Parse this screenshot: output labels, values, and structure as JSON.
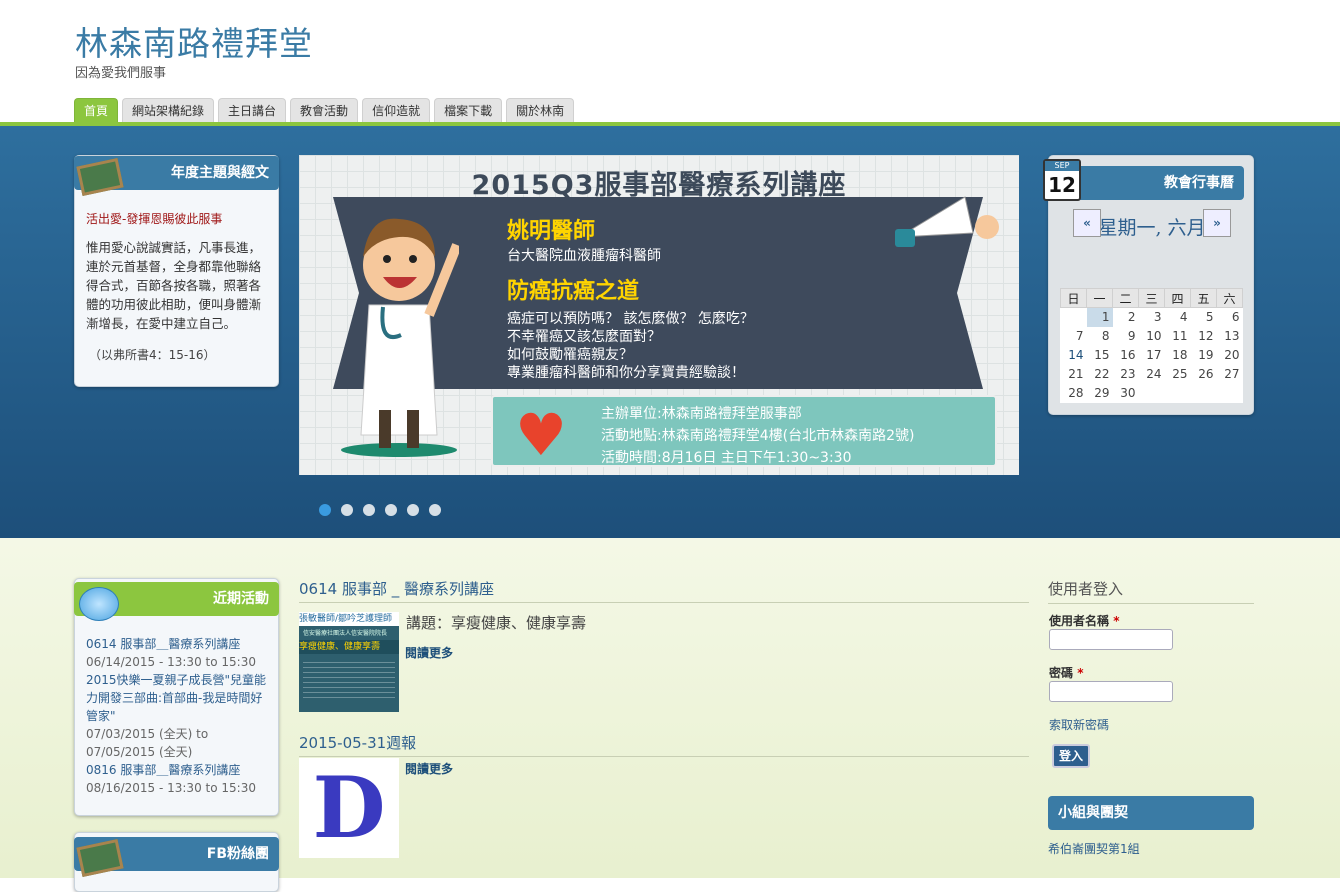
{
  "header": {
    "site_name": "林森南路禮拜堂",
    "slogan": "因為愛我們服事"
  },
  "nav": {
    "tabs": [
      "首頁",
      "網站架構紀錄",
      "主日講台",
      "教會活動",
      "信仰造就",
      "檔案下載",
      "關於林南"
    ],
    "active": 0
  },
  "theme_block": {
    "title": "年度主題與經文",
    "subtitle": "活出愛-發揮恩賜彼此服事",
    "text": "惟用愛心說誠實話，凡事長進，連於元首基督，全身都靠他聯絡得合式，百節各按各職，照著各體的功用彼此相助，便叫身體漸漸增長，在愛中建立自己。",
    "reference": "（以弗所書4：15-16）"
  },
  "slide": {
    "title": "2015Q3服事部醫療系列講座",
    "doctor_name": "姚明醫師",
    "doctor_role": "台大醫院血液腫瘤科醫師",
    "talk_title": "防癌抗癌之道",
    "questions": [
      "癌症可以預防嗎？ 該怎麼做？ 怎麼吃？",
      "不幸罹癌又該怎麼面對？",
      "如何鼓勵罹癌親友？",
      "專業腫瘤科醫師和你分享寶貴經驗談！"
    ],
    "info": [
      "主辦單位:林森南路禮拜堂服事部",
      "活動地點:林森南路禮拜堂4樓(台北市林森南路2號)",
      "活動時間:8月16日 主日下午1:30~3:30"
    ],
    "dot_count": 6,
    "active_dot": 0
  },
  "calendar": {
    "title": "教會行事曆",
    "icon_month": "SEP",
    "icon_day": "12",
    "month_label": "星期一, 六月",
    "prev": "«",
    "next": "»",
    "weekdays": [
      "日",
      "一",
      "二",
      "三",
      "四",
      "五",
      "六"
    ],
    "weeks": [
      [
        "",
        "1",
        "2",
        "3",
        "4",
        "5",
        "6"
      ],
      [
        "7",
        "8",
        "9",
        "10",
        "11",
        "12",
        "13"
      ],
      [
        "14",
        "15",
        "16",
        "17",
        "18",
        "19",
        "20"
      ],
      [
        "21",
        "22",
        "23",
        "24",
        "25",
        "26",
        "27"
      ],
      [
        "28",
        "29",
        "30",
        "",
        "",
        "",
        ""
      ]
    ]
  },
  "events_block": {
    "title": "近期活動",
    "items": [
      {
        "title": "0614 服事部＿醫療系列講座",
        "date": "06/14/2015 - 13:30 to 15:30"
      },
      {
        "title": "2015快樂一夏親子成長營\"兒童能力開發三部曲:首部曲-我是時間好管家\"",
        "date": "07/03/2015 (全天) to 07/05/2015 (全天)"
      },
      {
        "title": "0816 服事部＿醫療系列講座",
        "date": "08/16/2015 - 13:30 to 15:30"
      }
    ]
  },
  "fb_block": {
    "title": "FB粉絲團"
  },
  "nodes": [
    {
      "title": "0614 服事部 _ 醫療系列講座",
      "teaser": "講題：享瘦健康、健康享壽",
      "read_more": "閱讀更多",
      "thumb": {
        "line1": "張敏醫師/鄒吟芝護理師",
        "line2": "信安醫療社團法人信安醫院院長",
        "line3": "享瘦健康、健康享壽",
        "line4": "林森南路禮拜堂服事部"
      }
    },
    {
      "title": "2015-05-31週報",
      "teaser": "",
      "read_more": "閱讀更多",
      "thumb": {
        "letter": "D"
      }
    }
  ],
  "login": {
    "title": "使用者登入",
    "username_label": "使用者名稱",
    "password_label": "密碼",
    "required_mark": "*",
    "forgot": "索取新密碼",
    "submit": "登入"
  },
  "groups": {
    "title": "小組與團契",
    "first_item": "希伯崙團契第1組"
  },
  "colors": {
    "brand_blue": "#3a7ba5",
    "accent_green": "#8cc63f",
    "slide_yellow": "#ffd400"
  }
}
